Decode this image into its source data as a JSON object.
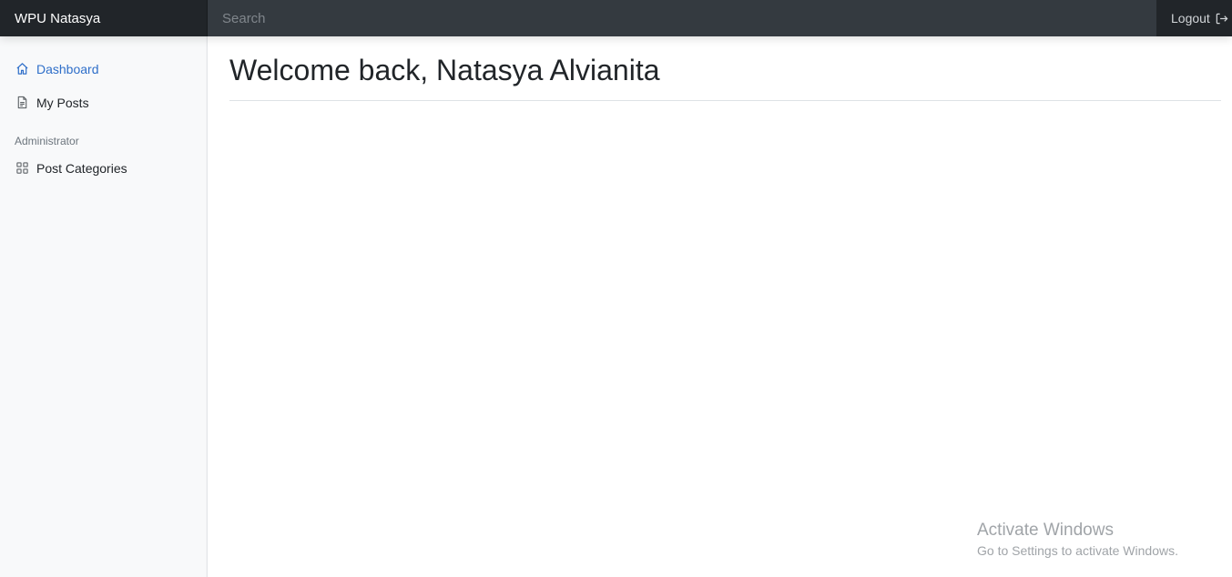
{
  "header": {
    "brand": "WPU Natasya",
    "search_placeholder": "Search",
    "logout_label": "Logout"
  },
  "sidebar": {
    "items": [
      {
        "label": "Dashboard",
        "icon": "home-icon",
        "active": true
      },
      {
        "label": "My Posts",
        "icon": "file-text-icon",
        "active": false
      }
    ],
    "admin_heading": "Administrator",
    "admin_items": [
      {
        "label": "Post Categories",
        "icon": "grid-icon",
        "active": false
      }
    ]
  },
  "main": {
    "title": "Welcome back, Natasya Alvianita"
  },
  "watermark": {
    "title": "Activate Windows",
    "subtitle": "Go to Settings to activate Windows."
  },
  "colors": {
    "topbar": "#343a40",
    "brand_bg": "#212529",
    "sidebar_bg": "#f8f9fa",
    "active_link": "#2f6fc9"
  }
}
